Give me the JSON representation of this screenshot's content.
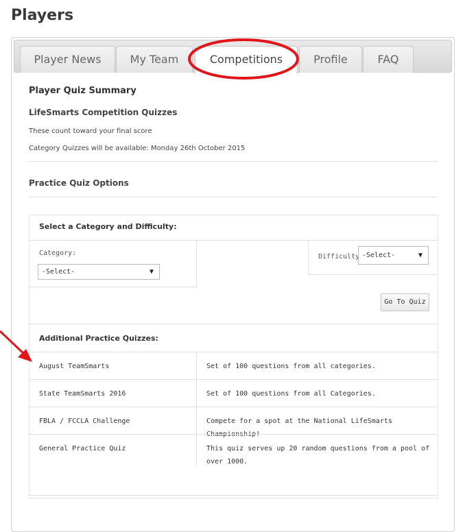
{
  "page": {
    "title": "Players"
  },
  "tabs": [
    {
      "label": "Player News"
    },
    {
      "label": "My Team"
    },
    {
      "label": "Competitions",
      "active": true
    },
    {
      "label": "Profile"
    },
    {
      "label": "FAQ"
    }
  ],
  "summary": {
    "heading": "Player Quiz Summary",
    "subheading": "LifeSmarts Competition Quizzes",
    "line1": "These count toward your final score",
    "line2": "Category Quizzes will be available: Monday 26th October 2015"
  },
  "practice": {
    "heading": "Practice Quiz Options",
    "select_heading": "Select a Category and Difficulty:",
    "category_label": "Category:",
    "category_value": "-Select-",
    "difficulty_label": "Difficulty:",
    "difficulty_value": "-Select-",
    "go_button": "Go To Quiz"
  },
  "additional": {
    "heading": "Additional Practice Quizzes:",
    "rows": [
      {
        "name": "August TeamSmarts",
        "desc": "Set of 100 questions from all categories."
      },
      {
        "name": "State TeamSmarts 2016",
        "desc": "Set of 100 questions from all Categories."
      },
      {
        "name": "FBLA / FCCLA Challenge",
        "desc": "Compete for a spot at the National LifeSmarts Championship!"
      },
      {
        "name": "General Practice Quiz",
        "desc": "This quiz serves up 20 random questions from a pool of over 1000."
      }
    ]
  },
  "annotations": {
    "circle_color": "#e0161b",
    "arrow_color": "#e0161b"
  }
}
